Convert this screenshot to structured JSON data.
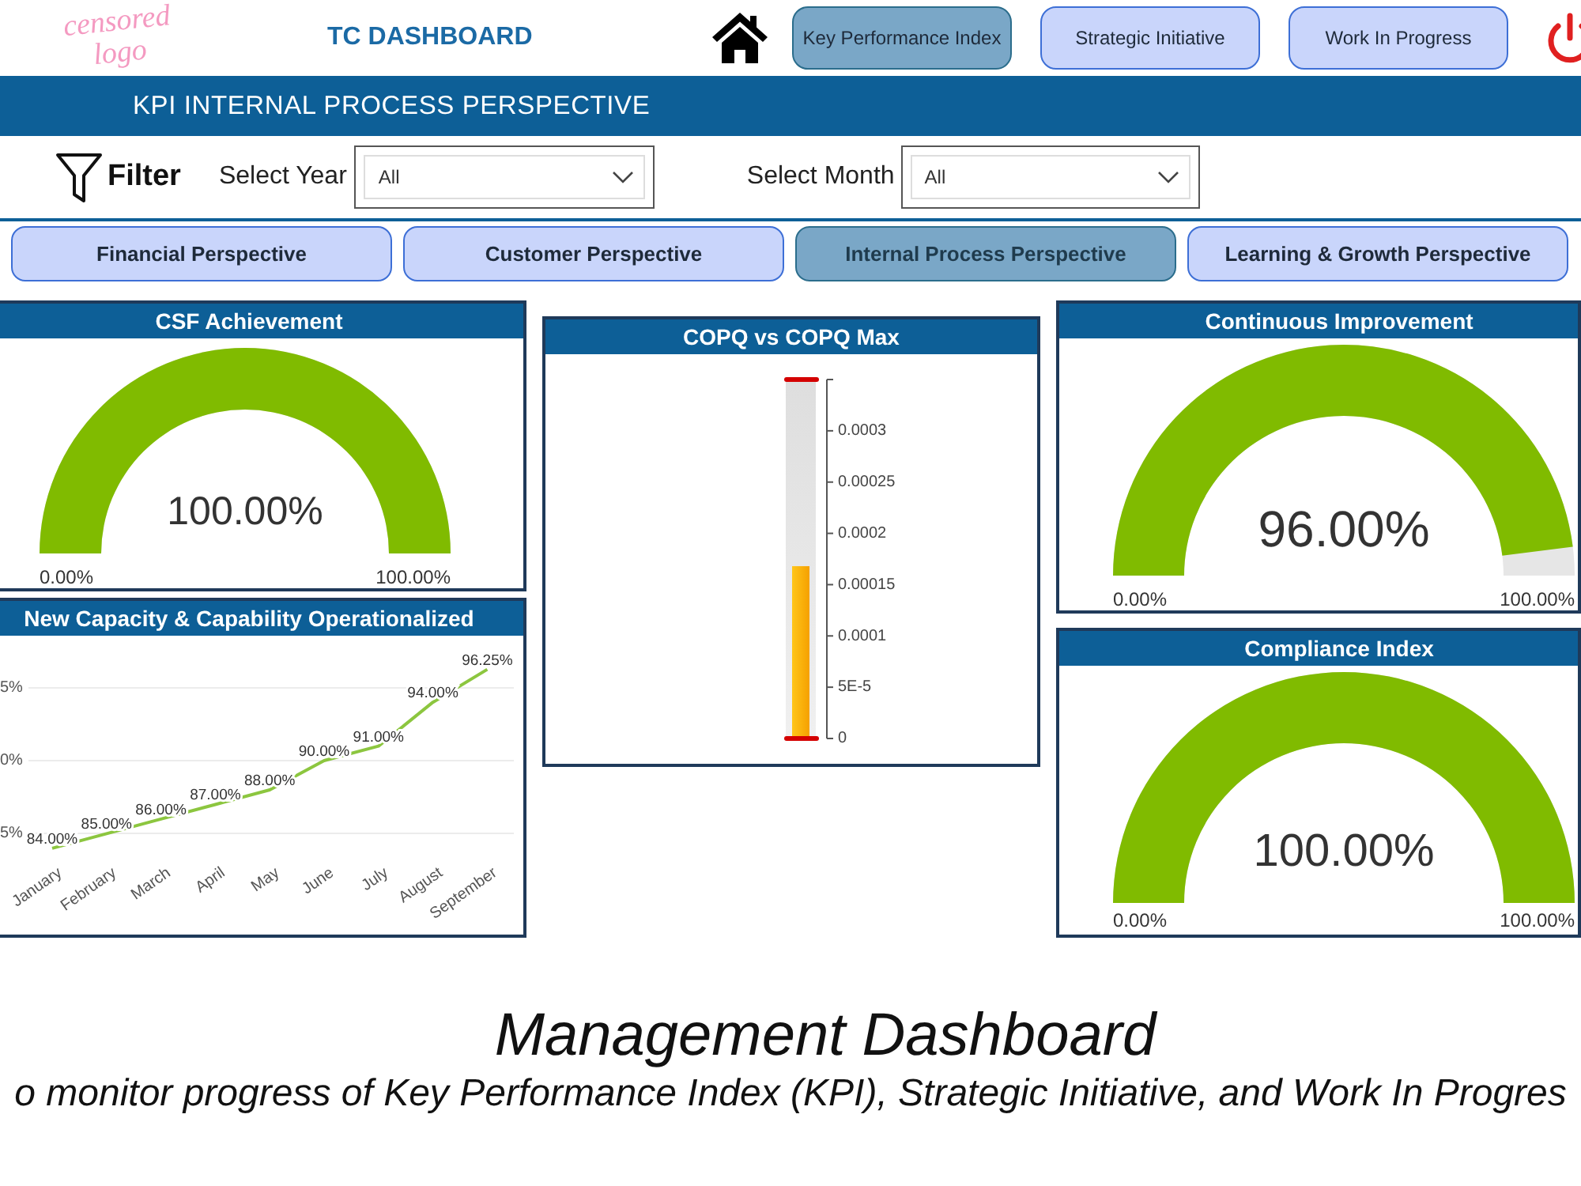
{
  "header": {
    "logo_text": "censored logo",
    "title": "TC DASHBOARD",
    "nav_buttons": [
      {
        "label": "Key Performance Index",
        "selected": true
      },
      {
        "label": "Strategic Initiative",
        "selected": false
      },
      {
        "label": "Work In Progress",
        "selected": false
      }
    ]
  },
  "banner": {
    "title": "KPI INTERNAL PROCESS PERSPECTIVE"
  },
  "filter_bar": {
    "label": "Filter",
    "filters": [
      {
        "label": "Select Year",
        "value": "All"
      },
      {
        "label": "Select Month",
        "value": "All"
      }
    ]
  },
  "perspective_tabs": [
    {
      "label": "Financial Perspective",
      "selected": false
    },
    {
      "label": "Customer Perspective",
      "selected": false
    },
    {
      "label": "Internal Process Perspective",
      "selected": true
    },
    {
      "label": "Learning & Growth Perspective",
      "selected": false
    }
  ],
  "columns": [
    {
      "panels": [
        {
          "kind": "gauge",
          "title": "CSF Achievement",
          "value_label": "100.00%",
          "level": 1,
          "min_label": "0.00%",
          "max_label": "100.00%"
        },
        {
          "kind": "chart",
          "title": "New Capacity & Capability Operationalized",
          "y_axis_labels": [
            "5%",
            "0%",
            "5%"
          ],
          "chart_data": {
            "type": "line",
            "categories": [
              "January",
              "February",
              "March",
              "April",
              "May",
              "June",
              "July",
              "August",
              "September"
            ],
            "series": [
              {
                "color": "#8cc63f",
                "values": [
                  84,
                  85,
                  86,
                  87,
                  88,
                  90,
                  91,
                  94,
                  96.25
                ],
                "value_labels": [
                  "84.00%",
                  "85.00%",
                  "86.00%",
                  "87.00%",
                  "88.00%",
                  "90.00%",
                  "91.00%",
                  "94.00%",
                  "96.25%"
                ]
              }
            ]
          }
        }
      ]
    },
    {
      "panels": [
        {
          "kind": "meter",
          "title": "COPQ vs COPQ Max",
          "level": 0.48,
          "scale_labels": [
            "0.0003",
            "0.00025",
            "0.0002",
            "0.00015",
            "0.0001",
            "5E-5",
            "0"
          ]
        }
      ]
    },
    {
      "panels": [
        {
          "kind": "gauge",
          "title": "Continuous Improvement",
          "value_label": "96.00%",
          "level": 0.96,
          "min_label": "0.00%",
          "max_label": "100.00%"
        },
        {
          "kind": "gauge",
          "title": "Compliance Index",
          "value_label": "100.00%",
          "level": 1,
          "min_label": "0.00%",
          "max_label": "100.00%"
        }
      ]
    }
  ],
  "caption": {
    "title": "Management Dashboard",
    "subtitle": "o monitor progress of Key Performance Index (KPI), Strategic Initiative, and Work In Progres"
  }
}
